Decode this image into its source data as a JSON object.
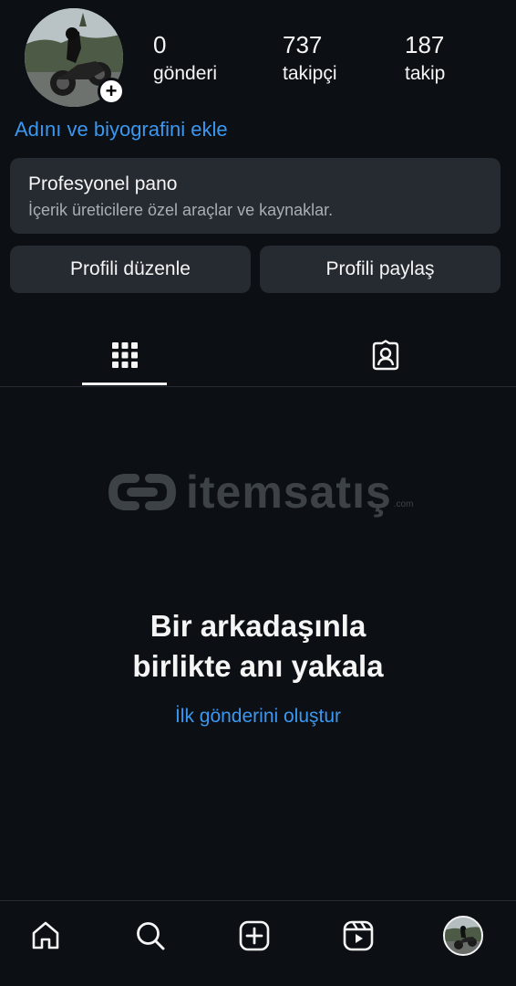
{
  "profile": {
    "stats": {
      "posts": {
        "count": "0",
        "label": "gönderi"
      },
      "followers": {
        "count": "737",
        "label": "takipçi"
      },
      "following": {
        "count": "187",
        "label": "takip"
      }
    },
    "add_bio_link": "Adını ve biyografini ekle",
    "avatar_icon": "profile-photo",
    "add_story_icon": "plus-icon"
  },
  "professional_dashboard": {
    "title": "Profesyonel pano",
    "subtitle": "İçerik üreticilere özel araçlar ve kaynaklar."
  },
  "actions": {
    "edit_profile": "Profili düzenle",
    "share_profile": "Profili paylaş"
  },
  "tabs": [
    {
      "icon": "grid-icon",
      "active": true
    },
    {
      "icon": "tagged-icon",
      "active": false
    }
  ],
  "watermark": {
    "text": "itemsatış",
    "suffix": ".com"
  },
  "empty_state": {
    "title_line1": "Bir arkadaşınla",
    "title_line2": "birlikte anı yakala",
    "cta": "İlk gönderini oluştur"
  },
  "bottom_nav": [
    {
      "icon": "home-icon"
    },
    {
      "icon": "search-icon"
    },
    {
      "icon": "create-icon"
    },
    {
      "icon": "reels-icon"
    },
    {
      "icon": "profile-avatar"
    }
  ],
  "colors": {
    "background": "#0c1014",
    "card": "#262a31",
    "link": "#3b97f0",
    "text": "#f5f5f5",
    "muted": "#a8aeb4"
  }
}
